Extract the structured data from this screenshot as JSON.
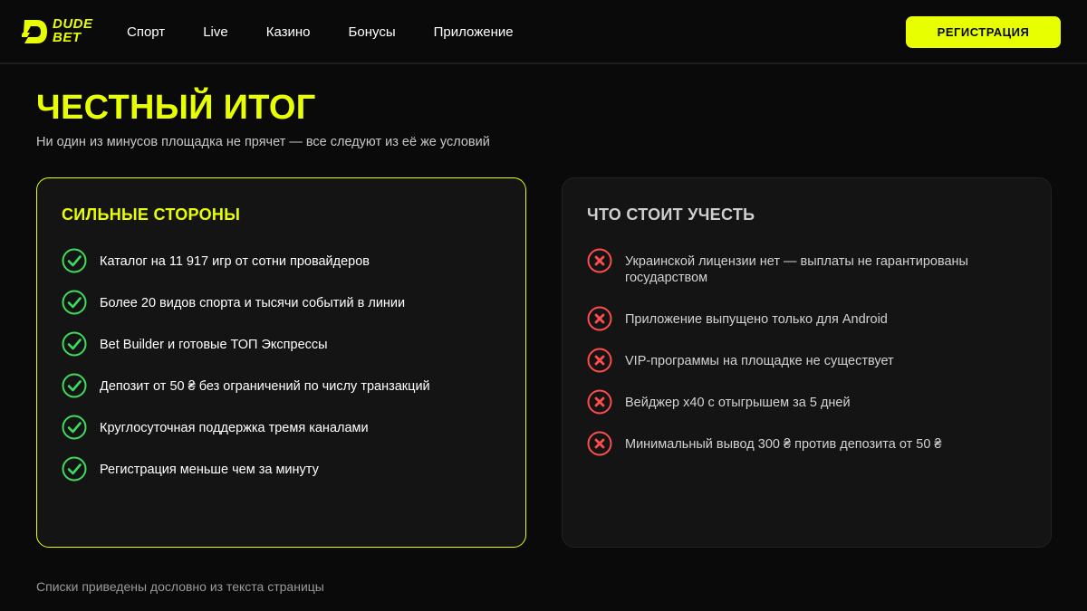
{
  "brand": {
    "logo_line1": "DUDE",
    "logo_line2": "BET",
    "accent_color": "#e8ff00"
  },
  "nav": {
    "items": [
      "Спорт",
      "Live",
      "Казино",
      "Бонусы",
      "Приложение"
    ]
  },
  "header": {
    "register_label": "РЕГИСТРАЦИЯ"
  },
  "main": {
    "title": "ЧЕСТНЫЙ ИТОГ",
    "subtitle": "Ни один из минусов площадка не прячет — все следуют из её же условий",
    "pros": {
      "title": "СИЛЬНЫЕ СТОРОНЫ",
      "icon": "check-circle-icon",
      "icon_color": "#3ddc5f",
      "items": [
        "Каталог на 11 917 игр от сотни провайдеров",
        "Более 20 видов спорта и тысячи событий в линии",
        "Bet Builder и готовые ТОП Экспрессы",
        "Депозит от 50 ₴ без ограничений по числу транзакций",
        "Круглосуточная поддержка тремя каналами",
        "Регистрация меньше чем за минуту"
      ]
    },
    "cons": {
      "title": "ЧТО СТОИТ УЧЕСТЬ",
      "icon": "x-circle-icon",
      "icon_color": "#ff4d4d",
      "items": [
        "Украинской лицензии нет — выплаты не гарантированы государством",
        "Приложение выпущено только для Android",
        "VIP-программы на площадке не существует",
        "Вейджер x40 с отыгрышем за 5 дней",
        "Минимальный вывод 300 ₴ против депозита от 50 ₴"
      ]
    },
    "footnote": "Списки приведены дословно из текста страницы"
  }
}
